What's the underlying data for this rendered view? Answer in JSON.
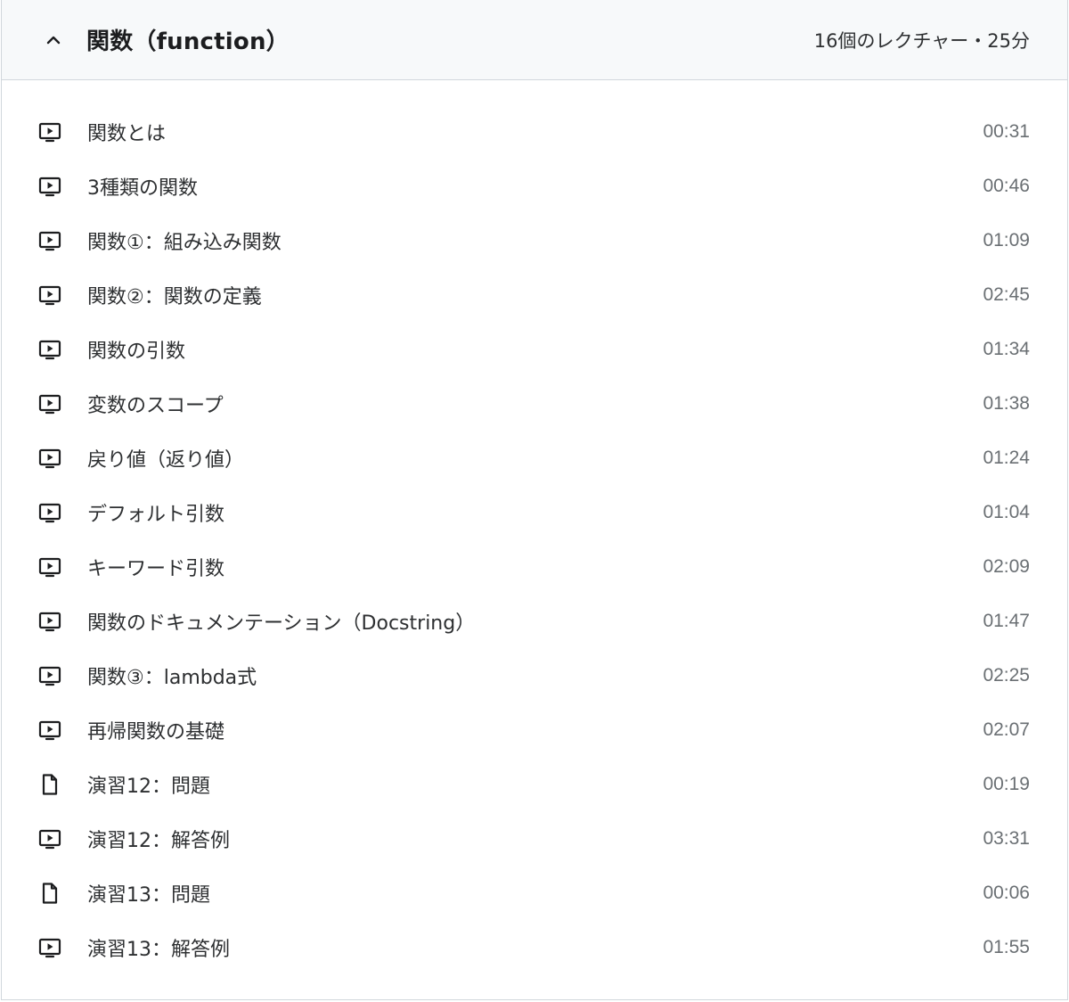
{
  "section": {
    "title": "関数（function）",
    "meta": "16個のレクチャー・25分",
    "expanded": true,
    "icon": "chevron-up-icon"
  },
  "lectures": [
    {
      "title": "関数とは",
      "duration": "00:31",
      "type": "video"
    },
    {
      "title": "3種類の関数",
      "duration": "00:46",
      "type": "video"
    },
    {
      "title": "関数①：組み込み関数",
      "duration": "01:09",
      "type": "video"
    },
    {
      "title": "関数②：関数の定義",
      "duration": "02:45",
      "type": "video"
    },
    {
      "title": "関数の引数",
      "duration": "01:34",
      "type": "video"
    },
    {
      "title": "変数のスコープ",
      "duration": "01:38",
      "type": "video"
    },
    {
      "title": "戻り値（返り値）",
      "duration": "01:24",
      "type": "video"
    },
    {
      "title": "デフォルト引数",
      "duration": "01:04",
      "type": "video"
    },
    {
      "title": "キーワード引数",
      "duration": "02:09",
      "type": "video"
    },
    {
      "title": "関数のドキュメンテーション（Docstring）",
      "duration": "01:47",
      "type": "video"
    },
    {
      "title": "関数③：lambda式",
      "duration": "02:25",
      "type": "video"
    },
    {
      "title": "再帰関数の基礎",
      "duration": "02:07",
      "type": "video"
    },
    {
      "title": "演習12：問題",
      "duration": "00:19",
      "type": "article"
    },
    {
      "title": "演習12：解答例",
      "duration": "03:31",
      "type": "video"
    },
    {
      "title": "演習13：問題",
      "duration": "00:06",
      "type": "article"
    },
    {
      "title": "演習13：解答例",
      "duration": "01:55",
      "type": "video"
    }
  ]
}
